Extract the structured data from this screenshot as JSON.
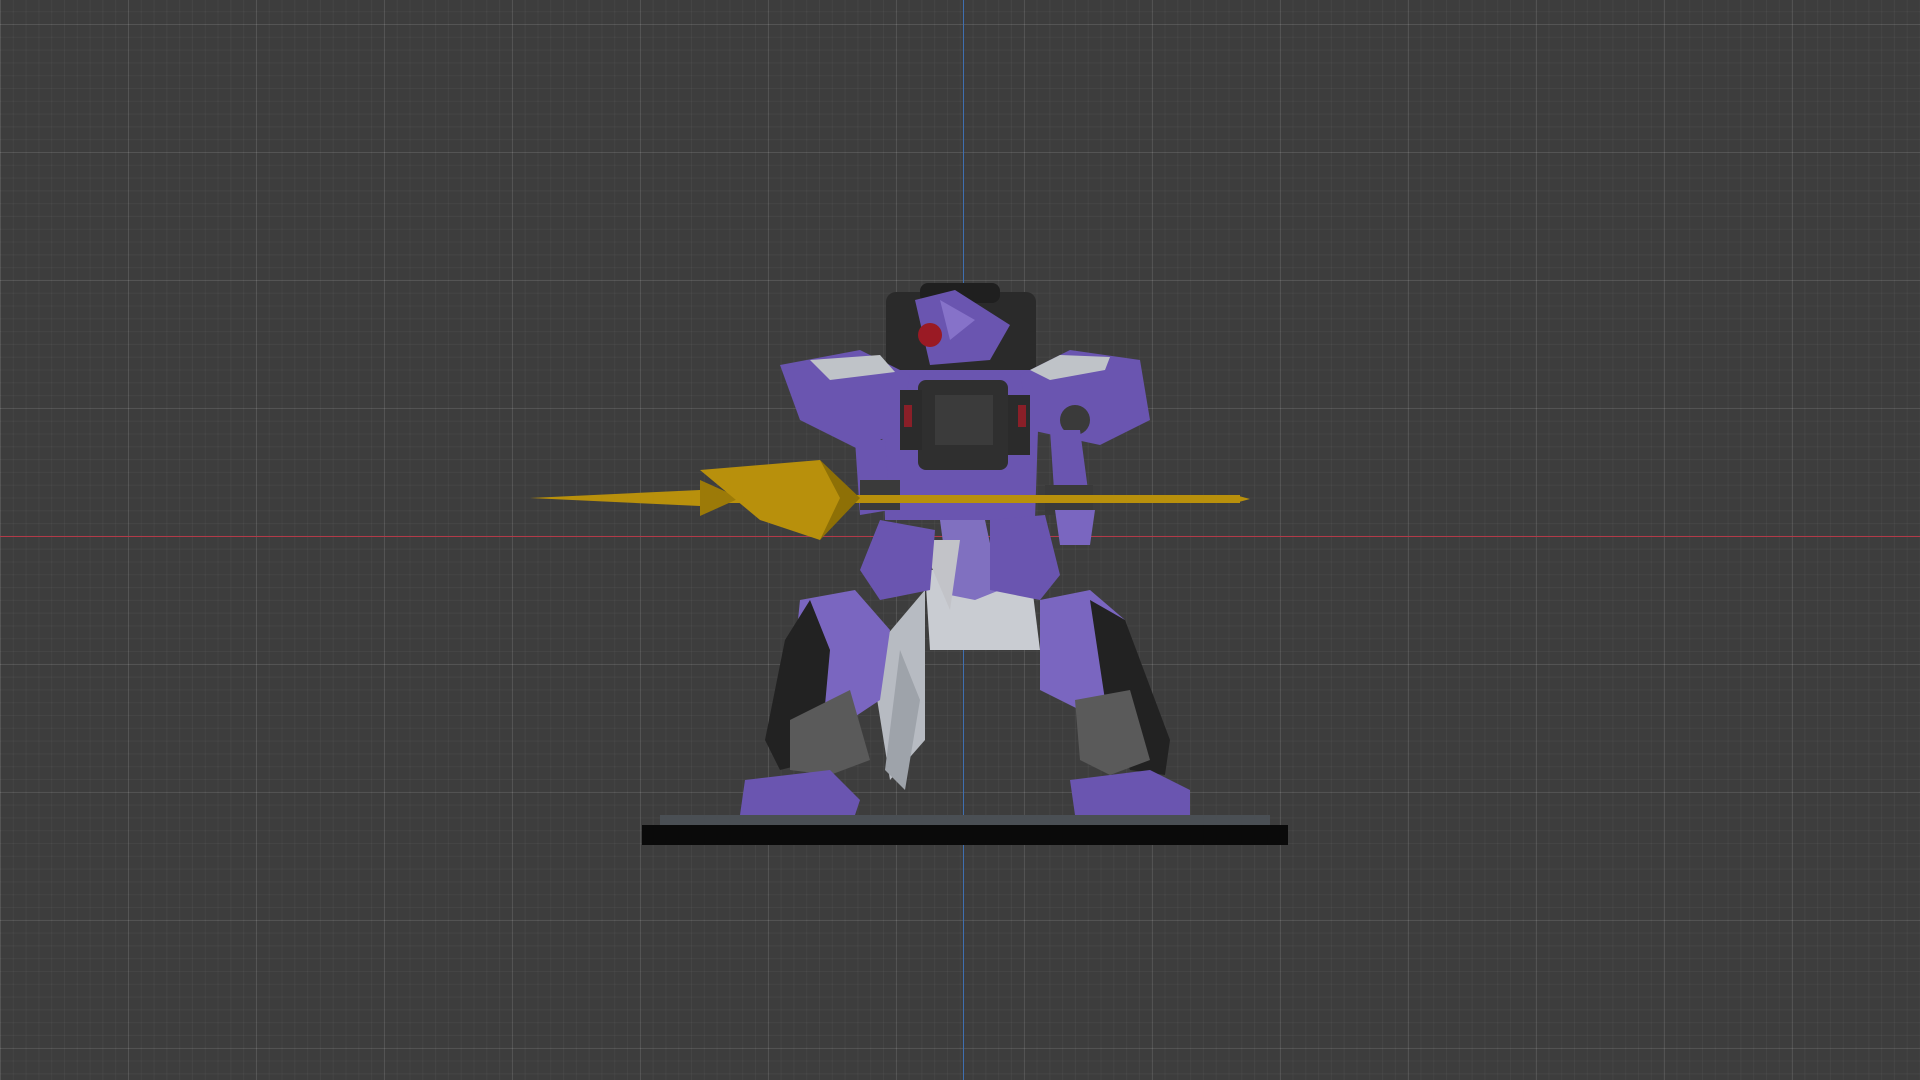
{
  "viewport": {
    "background": "#3d3d3d",
    "grid_visible": true,
    "axes": {
      "x_axis_color": "#b23a48",
      "y_axis_color": "#3f6fb0"
    }
  },
  "model": {
    "name": "mecha-robot-with-spear",
    "colors": {
      "armor_purple": "#6a55b0",
      "armor_dark": "#2c2c2c",
      "armor_grey": "#9aa0a6",
      "cloth_white": "#c9ccd2",
      "spear_gold": "#b8900c",
      "eye_red": "#9a1a24",
      "base_black": "#0a0a0a"
    }
  }
}
